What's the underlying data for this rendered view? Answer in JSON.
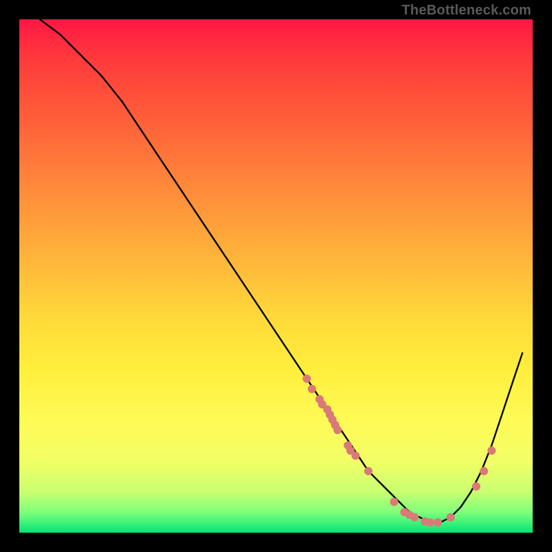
{
  "watermark": "TheBottleneck.com",
  "chart_data": {
    "type": "line",
    "title": "",
    "xlabel": "",
    "ylabel": "",
    "xlim": [
      0,
      100
    ],
    "ylim": [
      0,
      100
    ],
    "grid": false,
    "legend": false,
    "series": [
      {
        "name": "bottleneck-curve",
        "color": "#000000",
        "x": [
          4,
          8,
          12,
          16,
          20,
          24,
          28,
          32,
          36,
          40,
          44,
          48,
          52,
          56,
          58,
          60,
          62,
          64,
          66,
          68,
          70,
          72,
          74,
          76,
          78,
          80,
          82,
          84,
          86,
          88,
          90,
          92,
          94,
          96,
          98
        ],
        "y": [
          100,
          97,
          93,
          89,
          84,
          78,
          72,
          66,
          60,
          54,
          48,
          42,
          36,
          30,
          27,
          24,
          21,
          18,
          15,
          12,
          10,
          8,
          6,
          4,
          3,
          2,
          2,
          3,
          5,
          8,
          12,
          17,
          23,
          29,
          35
        ]
      }
    ],
    "markers": [
      {
        "name": "data-dots",
        "shape": "circle",
        "color": "#d97a77",
        "radius": 6,
        "points": [
          {
            "x": 56,
            "y": 30
          },
          {
            "x": 57,
            "y": 28
          },
          {
            "x": 58.5,
            "y": 26
          },
          {
            "x": 59,
            "y": 25
          },
          {
            "x": 60,
            "y": 24
          },
          {
            "x": 60.5,
            "y": 23
          },
          {
            "x": 61,
            "y": 22
          },
          {
            "x": 61.5,
            "y": 21
          },
          {
            "x": 62,
            "y": 20
          },
          {
            "x": 64,
            "y": 17
          },
          {
            "x": 64.5,
            "y": 16
          },
          {
            "x": 65.5,
            "y": 15
          },
          {
            "x": 68,
            "y": 12
          },
          {
            "x": 73,
            "y": 6
          },
          {
            "x": 75,
            "y": 4
          },
          {
            "x": 76,
            "y": 3.5
          },
          {
            "x": 77,
            "y": 3
          },
          {
            "x": 79,
            "y": 2.2
          },
          {
            "x": 80,
            "y": 2
          },
          {
            "x": 81.5,
            "y": 2
          },
          {
            "x": 84,
            "y": 3
          },
          {
            "x": 89,
            "y": 9
          },
          {
            "x": 90.5,
            "y": 12
          },
          {
            "x": 92,
            "y": 16
          }
        ]
      }
    ]
  }
}
